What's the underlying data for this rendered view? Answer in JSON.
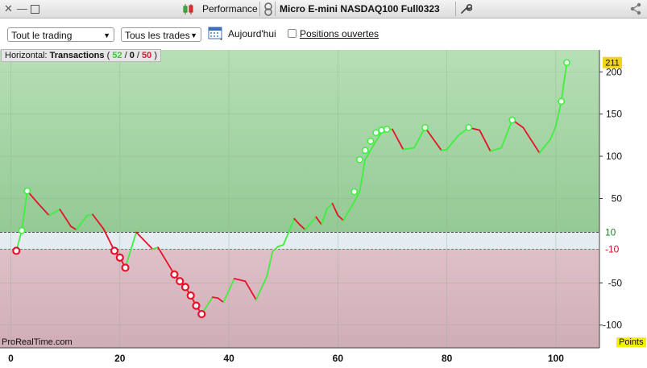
{
  "titlebar": {
    "section_label": "Performance",
    "instrument": "Micro E-mini NASDAQ100 Full0323"
  },
  "toolbar": {
    "scope_select": "Tout le trading",
    "trades_select": "Tous les trades",
    "date_label": "Aujourd'hui",
    "open_positions_label": "Positions ouvertes",
    "open_positions_checked": false
  },
  "chart_header": {
    "prefix": "Horizontal:",
    "bold": "Transactions",
    "open_paren": "(",
    "wins": "52",
    "sep1": "/",
    "neutral": "0",
    "sep2": "/",
    "losses": "50",
    "close_paren": ")"
  },
  "footer": {
    "brand": "ProRealTime.com",
    "units": "Points"
  },
  "colors": {
    "gain": "#3ef03e",
    "loss": "#e8102a",
    "profit_zone": "#a8d8a8",
    "loss_zone": "#dcb8c0",
    "last_value_badge": "#f2d21a"
  },
  "chart_data": {
    "type": "line",
    "title": "",
    "xlabel": "",
    "ylabel": "Points",
    "x_ticks": [
      0,
      20,
      40,
      60,
      80,
      100
    ],
    "y_ticks": [
      200,
      150,
      100,
      50,
      -50,
      -100
    ],
    "xlim": [
      -2,
      108
    ],
    "ylim": [
      -127,
      226
    ],
    "thresholds": [
      10,
      -10
    ],
    "last_value": 211,
    "grid": true,
    "series": [
      {
        "values": [
          [
            1,
            -12
          ],
          [
            2,
            12
          ],
          [
            3,
            59
          ],
          [
            5,
            44
          ],
          [
            7,
            30
          ],
          [
            9,
            37
          ],
          [
            11,
            17
          ],
          [
            12,
            13
          ],
          [
            14,
            30
          ],
          [
            15,
            31
          ],
          [
            17,
            14
          ],
          [
            19,
            -12
          ],
          [
            20,
            -20
          ],
          [
            21,
            -32
          ],
          [
            23,
            10
          ],
          [
            26,
            -10
          ],
          [
            27,
            -8
          ],
          [
            30,
            -40
          ],
          [
            31,
            -48
          ],
          [
            32,
            -55
          ],
          [
            33,
            -65
          ],
          [
            34,
            -77
          ],
          [
            35,
            -87
          ],
          [
            37,
            -67
          ],
          [
            38,
            -68
          ],
          [
            39,
            -73
          ],
          [
            41,
            -45
          ],
          [
            43,
            -48
          ],
          [
            45,
            -70
          ],
          [
            47,
            -42
          ],
          [
            48,
            -13
          ],
          [
            49,
            -7
          ],
          [
            50,
            -5
          ],
          [
            52,
            26
          ],
          [
            53,
            19
          ],
          [
            54,
            13
          ],
          [
            56,
            28
          ],
          [
            57,
            19
          ],
          [
            58,
            38
          ],
          [
            59,
            44
          ],
          [
            60,
            30
          ],
          [
            61,
            24
          ],
          [
            63,
            46
          ],
          [
            64,
            58
          ],
          [
            65,
            96
          ],
          [
            66,
            107
          ],
          [
            67,
            118
          ],
          [
            68,
            128
          ],
          [
            69,
            131
          ],
          [
            70,
            132
          ],
          [
            72,
            108
          ],
          [
            74,
            110
          ],
          [
            76,
            134
          ],
          [
            77,
            125
          ],
          [
            79,
            107
          ],
          [
            80,
            108
          ],
          [
            82,
            124
          ],
          [
            84,
            134
          ],
          [
            86,
            131
          ],
          [
            88,
            106
          ],
          [
            90,
            110
          ],
          [
            92,
            143
          ],
          [
            94,
            134
          ],
          [
            97,
            104
          ],
          [
            99,
            120
          ],
          [
            100,
            136
          ],
          [
            101,
            165
          ],
          [
            102,
            211
          ]
        ],
        "points_up": [
          [
            2,
            12
          ],
          [
            3,
            59
          ],
          [
            63,
            58
          ],
          [
            64,
            96
          ],
          [
            65,
            107
          ],
          [
            66,
            118
          ],
          [
            67,
            128
          ],
          [
            68,
            131
          ],
          [
            69,
            132
          ],
          [
            76,
            134
          ],
          [
            84,
            134
          ],
          [
            92,
            143
          ],
          [
            101,
            165
          ],
          [
            102,
            211
          ]
        ],
        "points_down": [
          [
            1,
            -12
          ],
          [
            19,
            -12
          ],
          [
            20,
            -20
          ],
          [
            21,
            -32
          ],
          [
            30,
            -40
          ],
          [
            31,
            -48
          ],
          [
            32,
            -55
          ],
          [
            33,
            -65
          ],
          [
            34,
            -77
          ],
          [
            35,
            -87
          ]
        ]
      }
    ]
  }
}
